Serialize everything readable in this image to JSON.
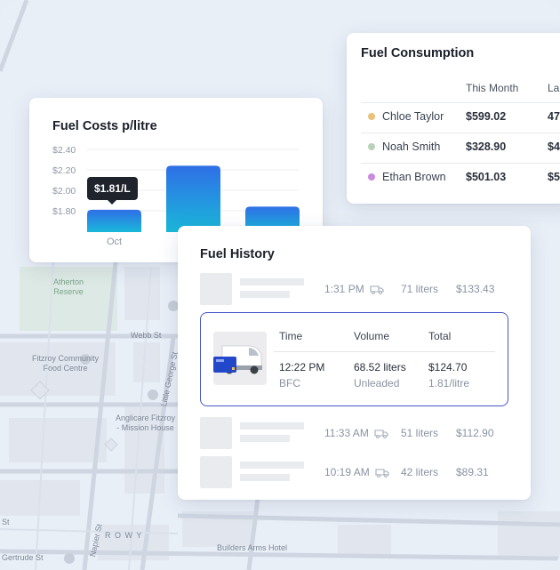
{
  "map": {
    "labels": {
      "reserve": "Atherton\nReserve",
      "webb": "Webb St",
      "fitzroy_centre": "Fitzroy Community\nFood Centre",
      "little_george": "Little George St",
      "anglicare": "Anglicare Fitzroy\n- Mission House",
      "napier": "Napier St",
      "rowy": "R O W Y",
      "gertrude": "Gertrude St",
      "builders": "Builders Arms Hotel",
      "st": "St"
    }
  },
  "fuel_costs": {
    "title": "Fuel Costs p/litre",
    "tooltip": "$1.81/L",
    "chart_data": {
      "type": "bar",
      "categories": [
        "Oct",
        "",
        ""
      ],
      "values": [
        1.81,
        2.24,
        1.84
      ],
      "ylim": [
        1.6,
        2.4
      ],
      "yticks": [
        "$2.40",
        "$2.20",
        "$2.00",
        "$1.80"
      ],
      "grid": true
    }
  },
  "consumption": {
    "title": "Fuel Consumption",
    "headers": [
      "This Month",
      "La"
    ],
    "rows": [
      {
        "name": "Chloe Taylor",
        "this_month": "$599.02",
        "last": "47",
        "color": "#e8c27a"
      },
      {
        "name": "Noah Smith",
        "this_month": "$328.90",
        "last": "$4",
        "color": "#b9d2b7"
      },
      {
        "name": "Ethan Brown",
        "this_month": "$501.03",
        "last": "$5",
        "color": "#c98ae0"
      }
    ]
  },
  "history": {
    "title": "Fuel History",
    "rows_before": [
      {
        "time": "1:31 PM",
        "volume": "71 liters",
        "total": "$133.43"
      }
    ],
    "selected": {
      "headers": {
        "time": "Time",
        "volume": "Volume",
        "total": "Total"
      },
      "time": "12:22 PM",
      "station": "BFC",
      "volume": "68.52 liters",
      "fuel_type": "Unleaded",
      "total": "$124.70",
      "price": "1.81/litre"
    },
    "rows_after": [
      {
        "time": "11:33 AM",
        "volume": "51 liters",
        "total": "$112.90"
      },
      {
        "time": "10:19 AM",
        "volume": "42 liters",
        "total": "$89.31"
      }
    ]
  }
}
